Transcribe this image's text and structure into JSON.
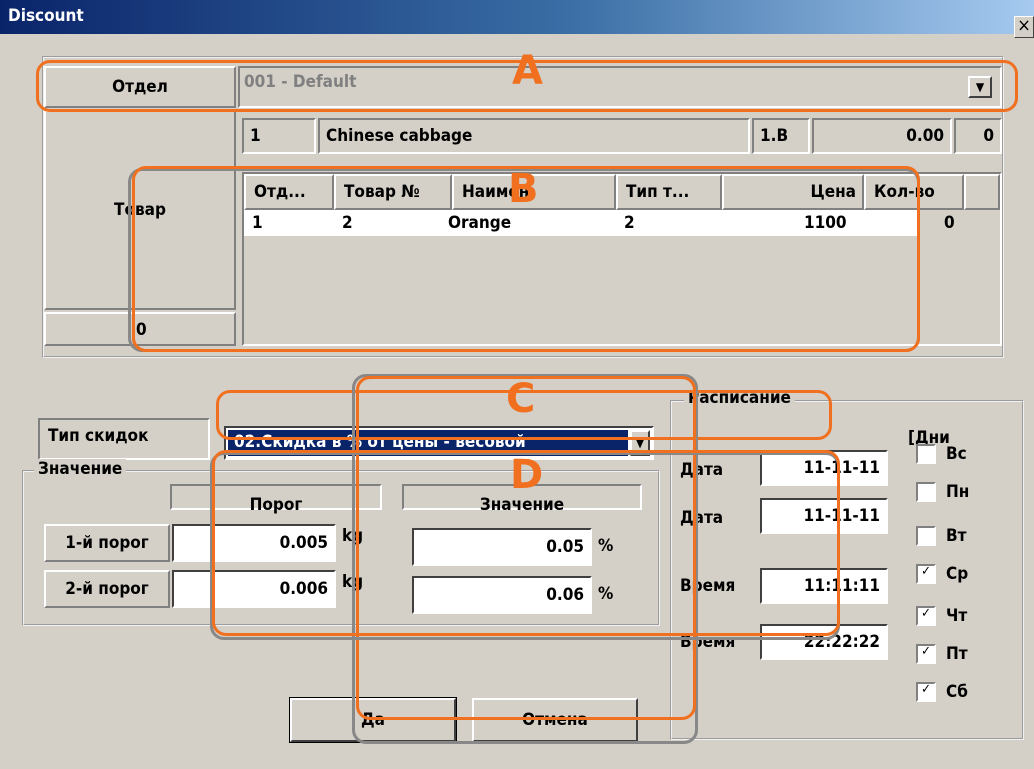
{
  "window": {
    "title": "Discount",
    "close_glyph": "×"
  },
  "department": {
    "label": "Отдел",
    "value": "001 - Default",
    "arrow": "▼"
  },
  "product": {
    "label": "Товар",
    "count": "0",
    "current": {
      "dept": "1",
      "name": "Chinese cabbage",
      "code": "1.В",
      "price": "0.00",
      "qty": "0"
    },
    "columns": [
      "Отд...",
      "Товар №",
      "Наимен.",
      "Тип т...",
      "Цена",
      "Кол-во"
    ],
    "rows": [
      {
        "dept": "1",
        "num": "2",
        "name": "Orange",
        "type": "2",
        "price": "1100",
        "qty": "0"
      }
    ]
  },
  "discount_type": {
    "label": "Тип скидок",
    "value": "02.Скидка в % от цены - весовой",
    "arrow": "▼"
  },
  "values": {
    "group_label": "Значение",
    "col_threshold": "Порог",
    "col_value": "Значение",
    "row1": {
      "label": "1-й порог",
      "threshold": "0.005",
      "unit": "kg",
      "value": "0.05",
      "pct": "%"
    },
    "row2": {
      "label": "2-й порог",
      "threshold": "0.006",
      "unit": "kg",
      "value": "0.06",
      "pct": "%"
    }
  },
  "schedule": {
    "label": "Расписание",
    "days_label": "[Дни",
    "date1_label": "Дата",
    "date1": "11-11-11",
    "date2_label": "Дата",
    "date2": "11-11-11",
    "time1_label": "Время",
    "time1": "11:11:11",
    "time2_label": "Время",
    "time2": "22:22:22",
    "days": [
      {
        "label": "Вс",
        "checked": false
      },
      {
        "label": "Пн",
        "checked": false
      },
      {
        "label": "Вт",
        "checked": false
      },
      {
        "label": "Ср",
        "checked": true
      },
      {
        "label": "Чт",
        "checked": true
      },
      {
        "label": "Пт",
        "checked": true
      },
      {
        "label": "Сб",
        "checked": true
      }
    ]
  },
  "buttons": {
    "ok": "Да",
    "cancel": "Отмена"
  },
  "annotations": {
    "a": "A",
    "b": "B",
    "c": "C",
    "d": "D",
    "color": "#f07020"
  }
}
